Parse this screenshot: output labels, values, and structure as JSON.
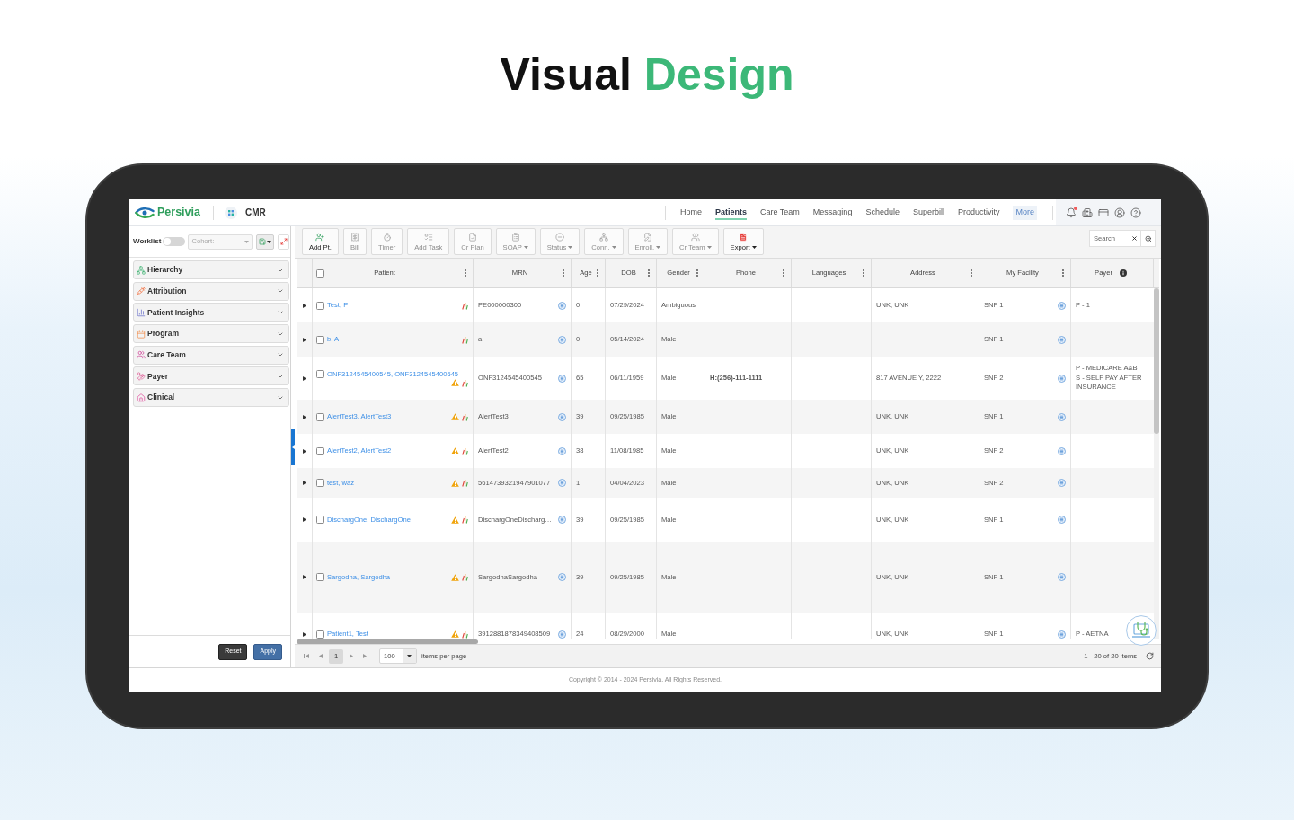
{
  "heading": {
    "title": "Visual",
    "highlight": "Design"
  },
  "app": {
    "logo": "Persivia",
    "module": "CMR",
    "nav": [
      {
        "label": "Home",
        "kind": "link",
        "selected": false
      },
      {
        "label": "Patients",
        "kind": "link",
        "selected": true
      },
      {
        "label": "Care Team",
        "kind": "link",
        "selected": false
      },
      {
        "label": "Messaging",
        "kind": "link",
        "selected": false
      },
      {
        "label": "Schedule",
        "kind": "link",
        "selected": false
      },
      {
        "label": "Superbill",
        "kind": "link",
        "selected": false
      },
      {
        "label": "Productivity",
        "kind": "link",
        "selected": false
      },
      {
        "label": "More",
        "kind": "menu",
        "selected": false
      }
    ],
    "notifications": {
      "unread": true
    }
  },
  "sidebar": {
    "worklist": {
      "label": "Worklist",
      "on": false
    },
    "cohort": {
      "placeholder": "Cohort:"
    },
    "filters": [
      {
        "label": "Hierarchy",
        "expanded": false
      },
      {
        "label": "Attribution",
        "expanded": false
      },
      {
        "label": "Patient Insights",
        "expanded": false
      },
      {
        "label": "Program",
        "expanded": false
      },
      {
        "label": "Care Team",
        "expanded": false
      },
      {
        "label": "Payer",
        "expanded": false
      },
      {
        "label": "Clinical",
        "expanded": false
      }
    ],
    "buttons": [
      {
        "label": "Reset",
        "kind": "secondary"
      },
      {
        "label": "Apply",
        "kind": "primary"
      }
    ]
  },
  "toolbar": {
    "buttons": [
      {
        "label": "Add Pt.",
        "disabled": false,
        "dropdown": false
      },
      {
        "label": "Bill",
        "disabled": true,
        "dropdown": false
      },
      {
        "label": "Timer",
        "disabled": true,
        "dropdown": false
      },
      {
        "label": "Add Task",
        "disabled": true,
        "dropdown": false
      },
      {
        "label": "Cr Plan",
        "disabled": true,
        "dropdown": false
      },
      {
        "label": "SOAP",
        "disabled": true,
        "dropdown": true
      },
      {
        "label": "Status",
        "disabled": true,
        "dropdown": true
      },
      {
        "label": "Conn.",
        "disabled": true,
        "dropdown": true
      },
      {
        "label": "Enroll.",
        "disabled": true,
        "dropdown": true
      },
      {
        "label": "Cr Team",
        "disabled": true,
        "dropdown": true
      },
      {
        "label": "Export",
        "disabled": false,
        "dropdown": true
      }
    ],
    "search": {
      "placeholder": "Search"
    }
  },
  "table": {
    "select_all": {
      "checked": false
    },
    "columns": [
      {
        "label": "Patient",
        "kind": "menu"
      },
      {
        "label": "MRN",
        "kind": "menu"
      },
      {
        "label": "Age",
        "kind": "menu"
      },
      {
        "label": "DOB",
        "kind": "menu"
      },
      {
        "label": "Gender",
        "kind": "menu"
      },
      {
        "label": "Phone",
        "kind": "menu"
      },
      {
        "label": "Languages",
        "kind": "menu"
      },
      {
        "label": "Address",
        "kind": "menu"
      },
      {
        "label": "My Facility",
        "kind": "menu"
      },
      {
        "label": "Payer",
        "kind": "info"
      }
    ],
    "rows": [
      {
        "patient": "Test, P",
        "checked": false,
        "expanded": false,
        "alert": false,
        "mrn": "PE000000300",
        "age": "0",
        "dob": "07/29/2024",
        "gender": "Ambiguous",
        "address": "UNK, UNK",
        "facility": "SNF 1",
        "payer": [
          "P - 1"
        ]
      },
      {
        "patient": "b, A",
        "checked": false,
        "expanded": false,
        "alert": false,
        "mrn": "a",
        "age": "0",
        "dob": "05/14/2024",
        "gender": "Male",
        "facility": "SNF 1"
      },
      {
        "patient": "ONF3124545400545, ONF3124545400545",
        "checked": false,
        "expanded": false,
        "alert": true,
        "mrn": "ONF3124545400545",
        "age": "65",
        "dob": "06/11/1959",
        "gender": "Male",
        "phone": "H:(256)-111-1111",
        "address": "817 AVENUE Y, 2222",
        "facility": "SNF 2",
        "payer": [
          "P - MEDICARE A&B",
          "S - SELF PAY AFTER INSURANCE"
        ]
      },
      {
        "patient": "AlertTest3, AlertTest3",
        "checked": false,
        "expanded": false,
        "alert": true,
        "mrn": "AlertTest3",
        "age": "39",
        "dob": "09/25/1985",
        "gender": "Male",
        "address": "UNK, UNK",
        "facility": "SNF 1"
      },
      {
        "patient": "AlertTest2, AlertTest2",
        "checked": false,
        "expanded": false,
        "alert": true,
        "mrn": "AlertTest2",
        "age": "38",
        "dob": "11/08/1985",
        "gender": "Male",
        "address": "UNK, UNK",
        "facility": "SNF 2"
      },
      {
        "patient": "test, waz",
        "checked": false,
        "expanded": false,
        "alert": true,
        "mrn": "5614739321947901077",
        "age": "1",
        "dob": "04/04/2023",
        "gender": "Male",
        "address": "UNK, UNK",
        "facility": "SNF 2"
      },
      {
        "patient": "DischargOne, DischargOne",
        "checked": false,
        "expanded": false,
        "alert": true,
        "mrn": "DischargOneDischarg…",
        "age": "39",
        "dob": "09/25/1985",
        "gender": "Male",
        "address": "UNK, UNK",
        "facility": "SNF 1"
      },
      {
        "patient": "Sargodha, Sargodha",
        "checked": false,
        "expanded": false,
        "alert": true,
        "mrn": "SargodhaSargodha",
        "age": "39",
        "dob": "09/25/1985",
        "gender": "Male",
        "address": "UNK, UNK",
        "facility": "SNF 1"
      },
      {
        "patient": "Patient1, Test",
        "checked": false,
        "expanded": false,
        "alert": true,
        "mrn": "3912881878349408509",
        "age": "24",
        "dob": "08/29/2000",
        "gender": "Male",
        "address": "UNK, UNK",
        "facility": "SNF 1",
        "payer": [
          "P - AETNA"
        ]
      }
    ]
  },
  "pager": {
    "pages": [
      {
        "label": "1",
        "selected": true
      }
    ],
    "page_size": "100",
    "page_size_label": "items per page",
    "summary": "1 - 20 of 20 items"
  },
  "footer": {
    "copyright": "Copyright © 2014 - 2024 Persivia. All Rights Reserved."
  }
}
